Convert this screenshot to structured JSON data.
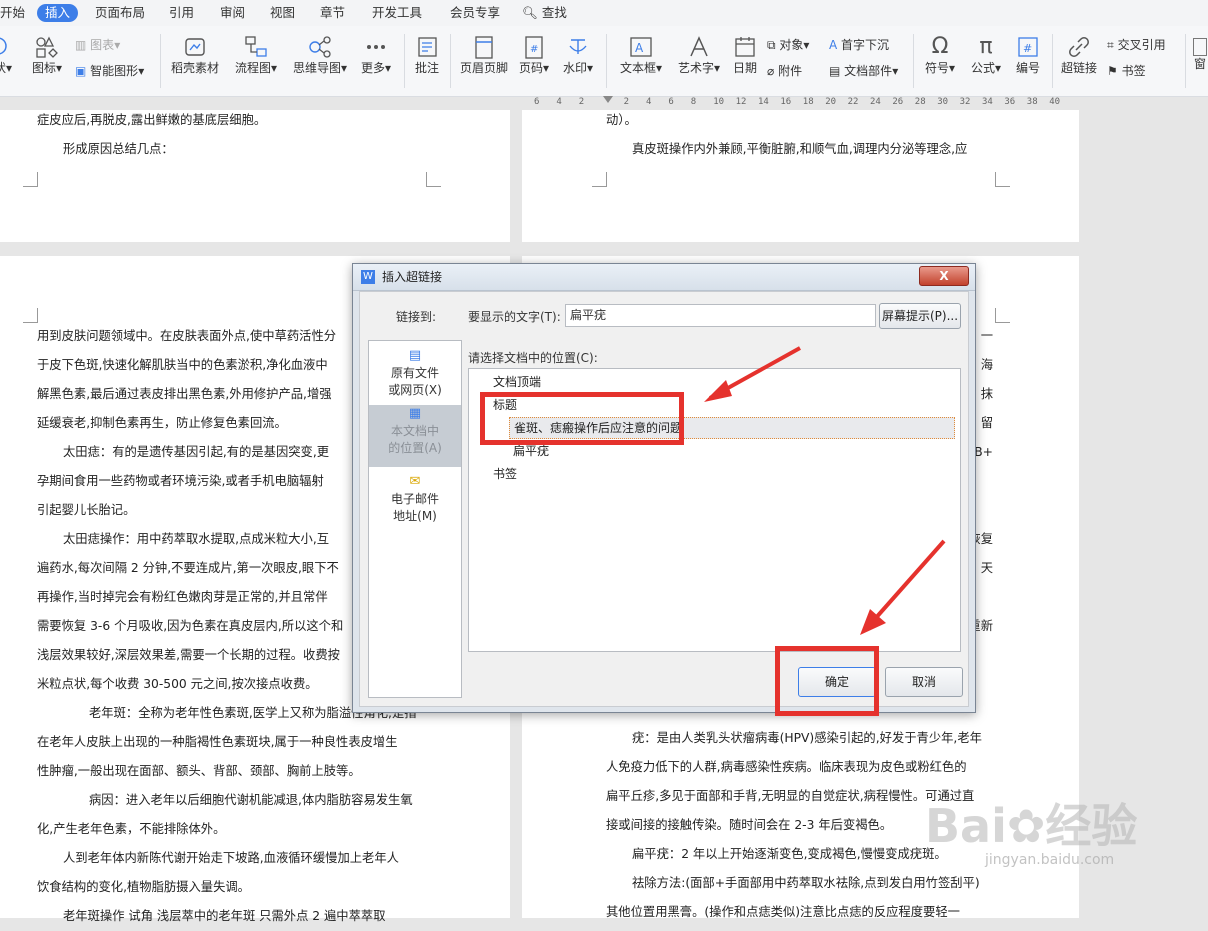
{
  "menu": {
    "items": [
      "开始",
      "插入",
      "页面布局",
      "引用",
      "审阅",
      "视图",
      "章节",
      "开发工具",
      "会员专享"
    ],
    "active": "插入",
    "search_label": "查找"
  },
  "ribbon": {
    "shape_label": "状",
    "icon_label": "图标",
    "chart_label": "图表",
    "smartart_label": "智能图形",
    "wps_material": "稻壳素材",
    "flowchart": "流程图",
    "mindmap": "思维导图",
    "more": "更多",
    "comment": "批注",
    "header_footer": "页眉页脚",
    "page_number": "页码",
    "watermark": "水印",
    "textbox": "文本框",
    "wordart": "艺术字",
    "date": "日期",
    "object": "对象",
    "attachment": "附件",
    "dropcap": "首字下沉",
    "doc_parts": "文档部件",
    "symbol": "符号",
    "formula": "公式",
    "numbering": "编号",
    "hyperlink": "超链接",
    "crossref": "交叉引用",
    "bookmark": "书签",
    "window": "窗"
  },
  "ruler": [
    "6",
    "4",
    "2",
    "",
    "2",
    "4",
    "6",
    "8",
    "10",
    "12",
    "14",
    "16",
    "18",
    "20",
    "22",
    "24",
    "26",
    "28",
    "30",
    "32",
    "34",
    "36",
    "38",
    "40"
  ],
  "doc": {
    "top_left_1": "症皮应后,再脱皮,露出鲜嫩的基底层细胞。",
    "top_left_2": "形成原因总结几点：",
    "top_right_1": "动）。",
    "top_right_2": "真皮斑操作内外兼顾,平衡脏腑,和顺气血,调理内分泌等理念,应",
    "left_lines": [
      "用到皮肤问题领域中。在皮肤表面外点,使中草药活性分",
      "于皮下色斑,快速化解肌肤当中的色素淤积,净化血液中",
      "解黑色素,最后通过表皮排出黑色素,外用修护产品,增强",
      "延缓衰老,抑制色素再生，防止修复色素回流。",
      "太田痣：有的是遗传基因引起,有的是基因突变,更",
      "孕期间食用一些药物或者环境污染,或者手机电脑辐射",
      "引起婴儿长胎记。",
      "太田痣操作：用中药萃取水提取,点成米粒大小,互",
      "遍药水,每次间隔 2 分钟,不要连成片,第一次眼皮,眼下不",
      "再操作,当时掉完会有粉红色嫩肉芽是正常的,并且常伴",
      "需要恢复 3-6 个月吸收,因为色素在真皮层内,所以这个和",
      "浅层效果较好,深层效果差,需要一个长期的过程。收费按",
      "米粒点状,每个收费 30-500 元之间,按次接点收费。",
      "老年斑：全称为老年性色素斑,医学上又称为脂溢性角化,是指",
      "在老年人皮肤上出现的一种脂褐性色素斑块,属于一种良性表皮增生",
      "性肿瘤,一般出现在面部、额头、背部、颈部、胸前上肢等。",
      "病因：进入老年以后细胞代谢机能减退,体内脂肪容易发生氧",
      "化,产生老年色素，不能排除体外。",
      "人到老年体内新陈代谢开始走下坡路,血液循环缓慢加上老年人",
      "饮食结构的变化,植物脂肪摄入量失调。",
      "老年斑操作 试角 浅层萃中的老年斑 只需外点 2 遍中萃萃取"
    ],
    "right_edge": [
      "一",
      "海",
      "抹",
      "留",
      "B+",
      "",
      "",
      "恢复",
      "天",
      "",
      "重新"
    ],
    "right_lines": [
      "疣：是由人类乳头状瘤病毒(HPV)感染引起的,好发于青少年,老年",
      "人免疫力低下的人群,病毒感染性疾病。临床表现为皮色或粉红色的",
      "扁平丘疹,多见于面部和手背,无明显的自觉症状,病程慢性。可通过直",
      "接或间接的接触传染。随时间会在 2-3 年后变褐色。",
      "扁平疣：2 年以上开始逐渐变色,变成褐色,慢慢变成疣斑。",
      "祛除方法:(面部+手面部用中药萃取水祛除,点到发白用竹签刮平)",
      "其他位置用黑膏。(操作和点痣类似)注意比点痣的反应程度要轻一"
    ]
  },
  "dialog": {
    "title": "插入超链接",
    "link_to_label": "链接到:",
    "display_text_label": "要显示的文字(T):",
    "display_text_value": "扁平疣",
    "screen_tip_button": "屏幕提示(P)...",
    "location_label": "请选择文档中的位置(C):",
    "sidebar": [
      {
        "line1": "原有文件",
        "line2": "或网页(X)"
      },
      {
        "line1": "本文档中",
        "line2": "的位置(A)"
      },
      {
        "line1": "电子邮件",
        "line2": "地址(M)"
      }
    ],
    "tree": {
      "doc_top": "文档顶端",
      "headings": "标题",
      "heading_1": "雀斑、痣瘢操作后应注意的问题",
      "heading_2": "扁平疣",
      "bookmarks": "书签"
    },
    "ok_button": "确定",
    "cancel_button": "取消",
    "close_symbol": "X"
  },
  "watermark": {
    "brand": "Bai",
    "brand2": "经验",
    "url": "jingyan.baidu.com"
  },
  "colors": {
    "accent": "#3d7ee8",
    "annotation_red": "#e5322d"
  }
}
